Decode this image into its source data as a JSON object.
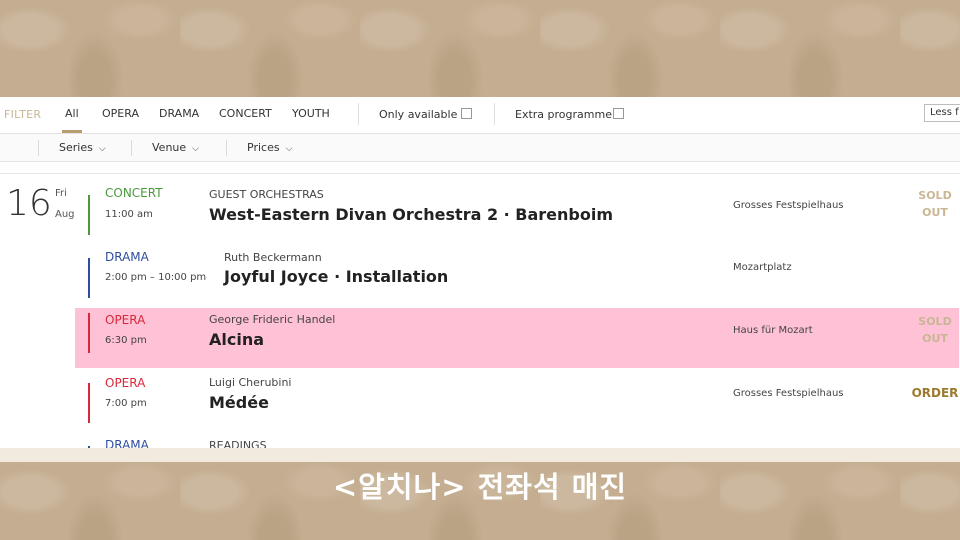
{
  "filterbar": {
    "label": "FILTER",
    "tabs": [
      {
        "label": "All",
        "active": true
      },
      {
        "label": "OPERA"
      },
      {
        "label": "DRAMA"
      },
      {
        "label": "CONCERT"
      },
      {
        "label": "YOUTH"
      }
    ],
    "only_available": "Only available",
    "extra_programme": "Extra programme",
    "less_button": "Less f"
  },
  "selectbar": {
    "series": "Series",
    "venue": "Venue",
    "prices": "Prices"
  },
  "date": {
    "day_num": "16",
    "weekday": "Fri",
    "month": "Aug"
  },
  "events": [
    {
      "category": "CONCERT",
      "time": "11:00 am",
      "organizer": "GUEST ORCHESTRAS",
      "title": "West-Eastern Divan Orchestra 2 · Barenboim",
      "venue": "Grosses Festspielhaus",
      "status_line1": "SOLD",
      "status_line2": "OUT"
    },
    {
      "category": "DRAMA",
      "time": "2:00 pm – 10:00 pm",
      "organizer": "Ruth Beckermann",
      "title": "Joyful Joyce · Installation",
      "venue": "Mozartplatz",
      "status_line1": "",
      "status_line2": ""
    },
    {
      "category": "OPERA",
      "time": "6:30 pm",
      "organizer": "George Frideric Handel",
      "title": "Alcina",
      "venue": "Haus für Mozart",
      "status_line1": "SOLD",
      "status_line2": "OUT"
    },
    {
      "category": "OPERA",
      "time": "7:00 pm",
      "organizer": "Luigi Cherubini",
      "title": "Médée",
      "venue": "Grosses Festspielhaus",
      "status_line1": "ORDER",
      "status_line2": ""
    },
    {
      "category": "DRAMA",
      "time": "",
      "organizer": "READINGS",
      "title": "",
      "venue": "",
      "status_line1": "",
      "status_line2": ""
    }
  ],
  "colors": {
    "concert": "#4a9a3c",
    "drama": "#2e4d9e",
    "opera": "#d9283b",
    "highlight": "#ffc1d6",
    "accent": "#b89d6e",
    "sold_out": "#c9b694",
    "order": "#9b7a2e"
  },
  "icons": {
    "dropdown": "chevron-down-icon",
    "checkbox": "checkbox-icon"
  },
  "caption": "<알치나> 전좌석 매진"
}
